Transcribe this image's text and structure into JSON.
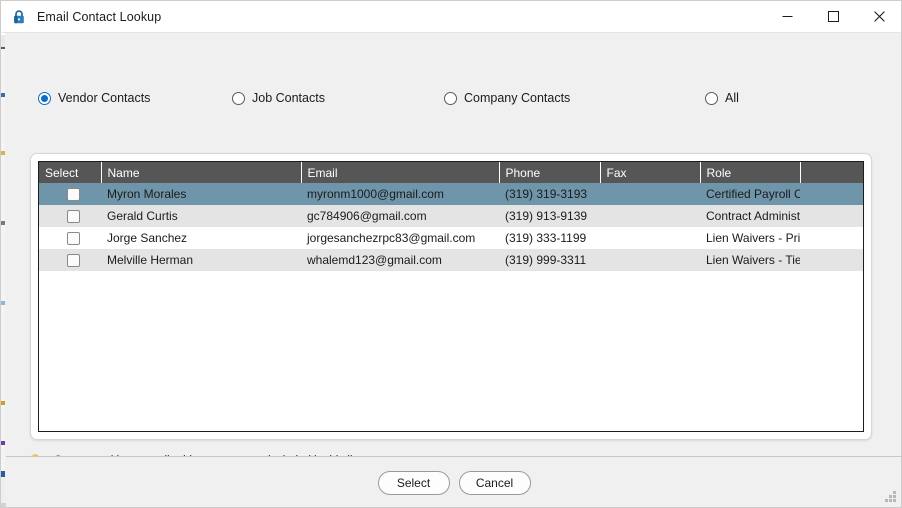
{
  "window": {
    "title": "Email Contact Lookup",
    "icon": "lock-icon",
    "controls": {
      "minimize": "–",
      "maximize": "□",
      "close": "✕"
    }
  },
  "filters": {
    "options": [
      {
        "label": "Vendor Contacts",
        "selected": true
      },
      {
        "label": "Job Contacts",
        "selected": false
      },
      {
        "label": "Company Contacts",
        "selected": false
      },
      {
        "label": "All",
        "selected": false
      }
    ]
  },
  "grid": {
    "columns": [
      "Select",
      "Name",
      "Email",
      "Phone",
      "Fax",
      "Role",
      ""
    ],
    "rows": [
      {
        "checked": false,
        "selected": true,
        "name": "Myron Morales",
        "email": "myronm1000@gmail.com",
        "phone": "(319) 319-3193",
        "fax": "",
        "role": "Certified Payroll C..."
      },
      {
        "checked": false,
        "selected": false,
        "name": "Gerald Curtis",
        "email": "gc784906@gmail.com",
        "phone": "(319) 913-9139",
        "fax": "",
        "role": "Contract Administ..."
      },
      {
        "checked": false,
        "selected": false,
        "name": "Jorge Sanchez",
        "email": "jorgesanchezrpc83@gmail.com",
        "phone": "(319) 333-1199",
        "fax": "",
        "role": "Lien Waivers - Pri..."
      },
      {
        "checked": false,
        "selected": false,
        "name": "Melville Herman",
        "email": "whalemd123@gmail.com",
        "phone": "(319) 999-3311",
        "fax": "",
        "role": "Lien Waivers - Tier"
      }
    ]
  },
  "hint": {
    "icon": "lightbulb-icon",
    "text": "Contacts without email addresses are not included in this list."
  },
  "footer": {
    "select_label": "Select",
    "cancel_label": "Cancel"
  },
  "colors": {
    "selected_row": "#6f95ab",
    "header_bg": "#565656",
    "accent": "#0d6cc4",
    "alt_row": "#e4e4e4",
    "dialog_bg": "#f0f0f0"
  }
}
